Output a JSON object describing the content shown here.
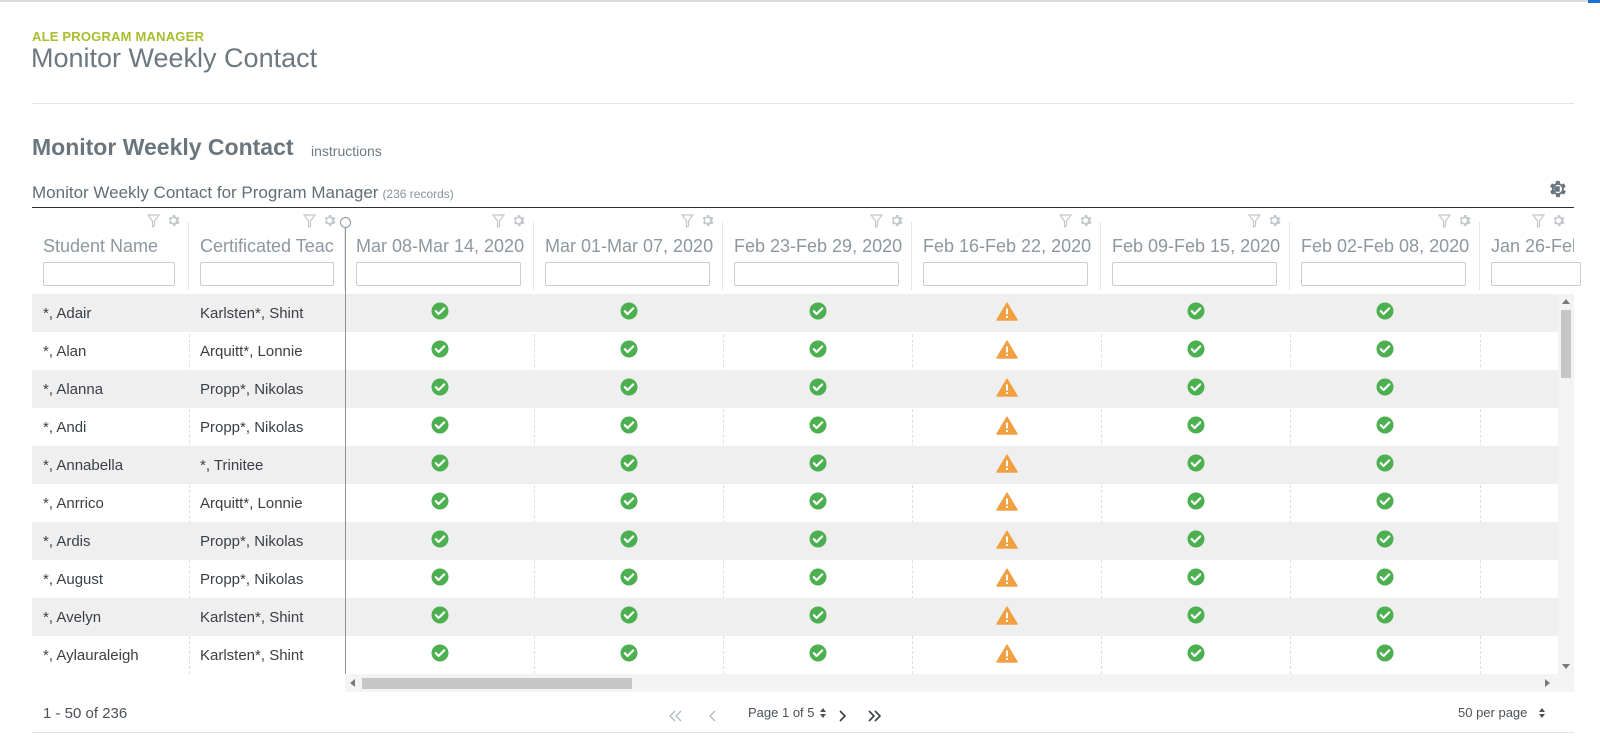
{
  "header": {
    "eyebrow": "ALE PROGRAM MANAGER",
    "title": "Monitor Weekly Contact"
  },
  "section": {
    "title": "Monitor Weekly Contact",
    "instructions_link": "instructions"
  },
  "grid": {
    "title": "Monitor Weekly Contact for Program Manager",
    "record_count": "(236 records)",
    "columns": [
      {
        "label": "Student Name",
        "filter_value": ""
      },
      {
        "label": "Certificated Teac",
        "filter_value": ""
      },
      {
        "label": "Mar 08-Mar 14, 2020",
        "filter_value": ""
      },
      {
        "label": "Mar 01-Mar 07, 2020",
        "filter_value": ""
      },
      {
        "label": "Feb 23-Feb 29, 2020",
        "filter_value": ""
      },
      {
        "label": "Feb 16-Feb 22, 2020",
        "filter_value": ""
      },
      {
        "label": "Feb 09-Feb 15, 2020",
        "filter_value": ""
      },
      {
        "label": "Feb 02-Feb 08, 2020",
        "filter_value": ""
      },
      {
        "label": "Jan 26-Feb",
        "filter_value": ""
      }
    ],
    "rows": [
      {
        "student": "*, Adair",
        "teacher": "Karlsten*, Shint",
        "weeks": [
          "ok",
          "ok",
          "ok",
          "warning",
          "ok",
          "ok",
          ""
        ]
      },
      {
        "student": "*, Alan",
        "teacher": "Arquitt*, Lonnie",
        "weeks": [
          "ok",
          "ok",
          "ok",
          "warning",
          "ok",
          "ok",
          ""
        ]
      },
      {
        "student": "*, Alanna",
        "teacher": "Propp*, Nikolas",
        "weeks": [
          "ok",
          "ok",
          "ok",
          "warning",
          "ok",
          "ok",
          ""
        ]
      },
      {
        "student": "*, Andi",
        "teacher": "Propp*, Nikolas",
        "weeks": [
          "ok",
          "ok",
          "ok",
          "warning",
          "ok",
          "ok",
          ""
        ]
      },
      {
        "student": "*, Annabella",
        "teacher": "*, Trinitee",
        "weeks": [
          "ok",
          "ok",
          "ok",
          "warning",
          "ok",
          "ok",
          ""
        ]
      },
      {
        "student": "*, Anrrico",
        "teacher": "Arquitt*, Lonnie",
        "weeks": [
          "ok",
          "ok",
          "ok",
          "warning",
          "ok",
          "ok",
          ""
        ]
      },
      {
        "student": "*, Ardis",
        "teacher": "Propp*, Nikolas",
        "weeks": [
          "ok",
          "ok",
          "ok",
          "warning",
          "ok",
          "ok",
          ""
        ]
      },
      {
        "student": "*, August",
        "teacher": "Propp*, Nikolas",
        "weeks": [
          "ok",
          "ok",
          "ok",
          "warning",
          "ok",
          "ok",
          ""
        ]
      },
      {
        "student": "*, Avelyn",
        "teacher": "Karlsten*, Shint",
        "weeks": [
          "ok",
          "ok",
          "ok",
          "warning",
          "ok",
          "ok",
          ""
        ]
      },
      {
        "student": "*, Aylauraleigh",
        "teacher": "Karlsten*, Shint",
        "weeks": [
          "ok",
          "ok",
          "ok",
          "warning",
          "ok",
          "ok",
          ""
        ]
      }
    ]
  },
  "pager": {
    "range": "1 - 50 of 236",
    "page_label": "Page 1 of 5",
    "per_page": "50 per page"
  },
  "colors": {
    "eyebrow": "#a9bd2d",
    "ok": "#4caf50",
    "warning": "#f0a040",
    "row_alt": "#efefef",
    "icon_gray": "#c4c8cc"
  },
  "icons": {
    "ok": "check-circle-icon",
    "warning": "warning-triangle-icon",
    "filter": "filter-icon",
    "settings": "gear-icon"
  }
}
